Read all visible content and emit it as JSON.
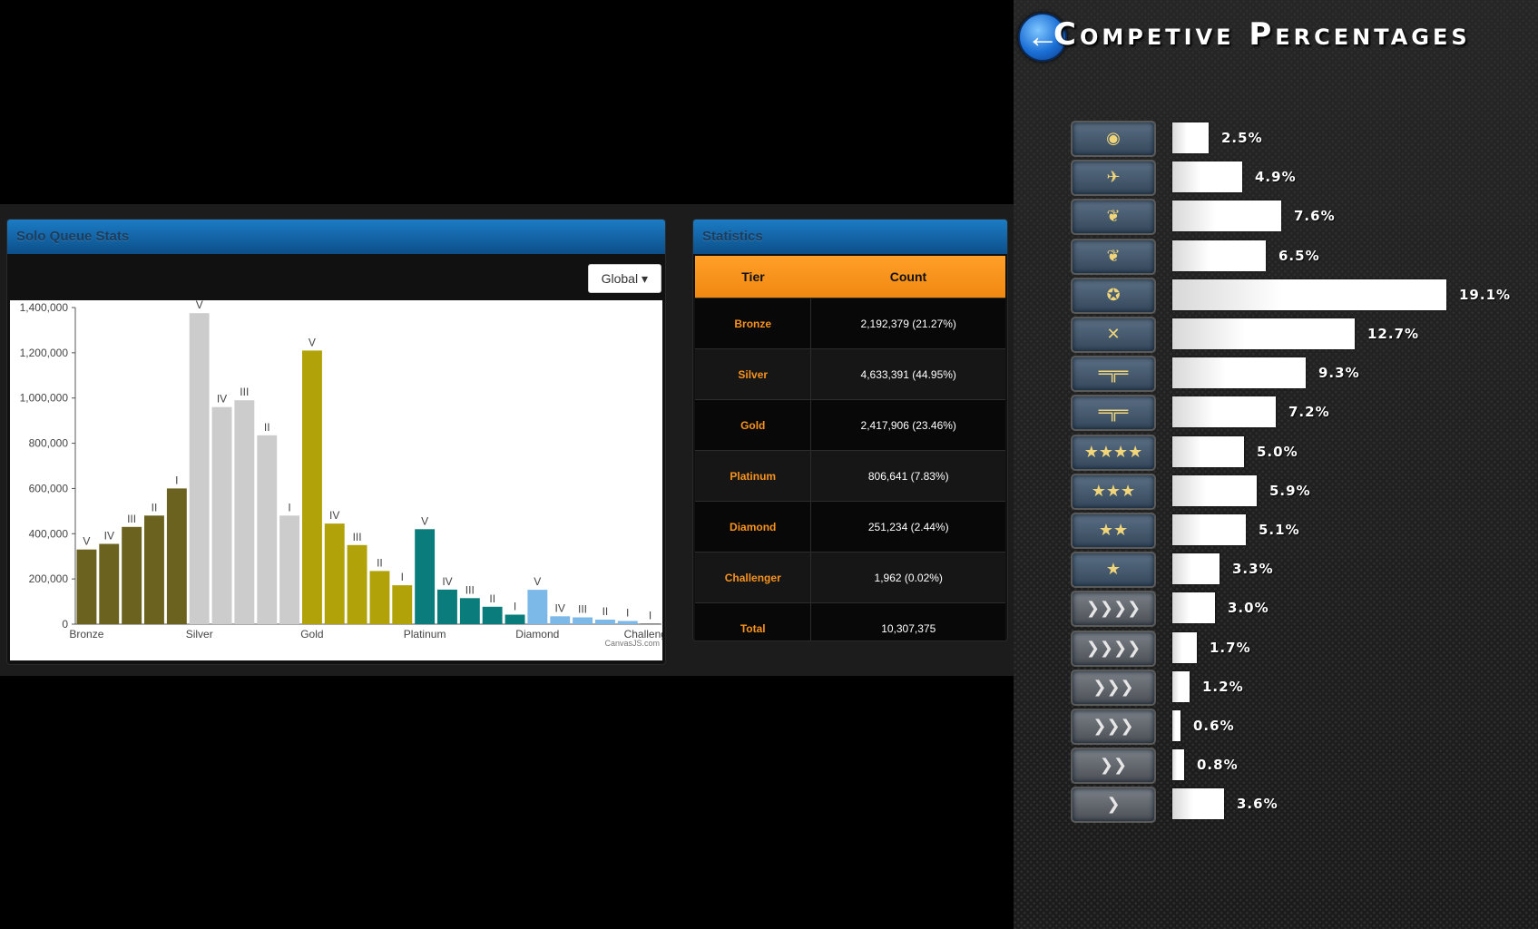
{
  "solo_panel": {
    "title": "Solo Queue Stats",
    "region_button": "Global ▾",
    "watermark": "CanvasJS.com"
  },
  "chart_data": {
    "type": "bar",
    "ylim": [
      0,
      1400000
    ],
    "yticks": [
      "0",
      "200,000",
      "400,000",
      "600,000",
      "800,000",
      "1,000,000",
      "1,200,000",
      "1,400,000"
    ],
    "tier_labels": [
      "Bronze",
      "Silver",
      "Gold",
      "Platinum",
      "Diamond",
      "Challenger"
    ],
    "bars": [
      {
        "tier": "Bronze",
        "division": "V",
        "value": 330000,
        "color": "#6b6220"
      },
      {
        "tier": "Bronze",
        "division": "IV",
        "value": 355000,
        "color": "#6b6220"
      },
      {
        "tier": "Bronze",
        "division": "III",
        "value": 430000,
        "color": "#6b6220"
      },
      {
        "tier": "Bronze",
        "division": "II",
        "value": 480000,
        "color": "#6b6220"
      },
      {
        "tier": "Bronze",
        "division": "I",
        "value": 600000,
        "color": "#6b6220"
      },
      {
        "tier": "Silver",
        "division": "V",
        "value": 1375000,
        "color": "#cccccc"
      },
      {
        "tier": "Silver",
        "division": "IV",
        "value": 960000,
        "color": "#cccccc"
      },
      {
        "tier": "Silver",
        "division": "III",
        "value": 990000,
        "color": "#cccccc"
      },
      {
        "tier": "Silver",
        "division": "II",
        "value": 835000,
        "color": "#cccccc"
      },
      {
        "tier": "Silver",
        "division": "I",
        "value": 480000,
        "color": "#cccccc"
      },
      {
        "tier": "Gold",
        "division": "V",
        "value": 1210000,
        "color": "#b1a20a"
      },
      {
        "tier": "Gold",
        "division": "IV",
        "value": 445000,
        "color": "#b1a20a"
      },
      {
        "tier": "Gold",
        "division": "III",
        "value": 350000,
        "color": "#b1a20a"
      },
      {
        "tier": "Gold",
        "division": "II",
        "value": 235000,
        "color": "#b1a20a"
      },
      {
        "tier": "Gold",
        "division": "I",
        "value": 172000,
        "color": "#b1a20a"
      },
      {
        "tier": "Platinum",
        "division": "V",
        "value": 420000,
        "color": "#0a7c7c"
      },
      {
        "tier": "Platinum",
        "division": "IV",
        "value": 153000,
        "color": "#0a7c7c"
      },
      {
        "tier": "Platinum",
        "division": "III",
        "value": 115000,
        "color": "#0a7c7c"
      },
      {
        "tier": "Platinum",
        "division": "II",
        "value": 77000,
        "color": "#0a7c7c"
      },
      {
        "tier": "Platinum",
        "division": "I",
        "value": 42000,
        "color": "#0a7c7c"
      },
      {
        "tier": "Diamond",
        "division": "V",
        "value": 152000,
        "color": "#7db9e8"
      },
      {
        "tier": "Diamond",
        "division": "IV",
        "value": 35000,
        "color": "#7db9e8"
      },
      {
        "tier": "Diamond",
        "division": "III",
        "value": 30000,
        "color": "#7db9e8"
      },
      {
        "tier": "Diamond",
        "division": "II",
        "value": 20000,
        "color": "#7db9e8"
      },
      {
        "tier": "Diamond",
        "division": "I",
        "value": 14000,
        "color": "#7db9e8"
      },
      {
        "tier": "Challenger",
        "division": "I",
        "value": 1962,
        "color": "#111111"
      }
    ]
  },
  "stats_panel": {
    "title": "Statistics",
    "headers": [
      "Tier",
      "Count"
    ],
    "rows": [
      {
        "tier": "Bronze",
        "count": "2,192,379 (21.27%)"
      },
      {
        "tier": "Silver",
        "count": "4,633,391 (44.95%)"
      },
      {
        "tier": "Gold",
        "count": "2,417,906 (23.46%)"
      },
      {
        "tier": "Platinum",
        "count": "806,641 (7.83%)"
      },
      {
        "tier": "Diamond",
        "count": "251,234 (2.44%)"
      },
      {
        "tier": "Challenger",
        "count": "1,962 (0.02%)"
      },
      {
        "tier": "Total",
        "count": "10,307,375"
      }
    ]
  },
  "competitive": {
    "title": "Competive Percentages",
    "ranks": [
      {
        "icon": "globe-icon",
        "glyph": "◉",
        "badge": "gold",
        "percent": 2.5,
        "label": "2.5%"
      },
      {
        "icon": "winged-emblem-icon",
        "glyph": "✈",
        "badge": "gold",
        "percent": 4.9,
        "label": "4.9%"
      },
      {
        "icon": "eagle-laurel-icon",
        "glyph": "❦",
        "badge": "gold",
        "percent": 7.6,
        "label": "7.6%"
      },
      {
        "icon": "eagle-icon",
        "glyph": "❦",
        "badge": "gold",
        "percent": 6.5,
        "label": "6.5%"
      },
      {
        "icon": "star-emblem-icon",
        "glyph": "✪",
        "badge": "gold",
        "percent": 19.1,
        "label": "19.1%"
      },
      {
        "icon": "crossed-rifles-icon",
        "glyph": "✕",
        "badge": "gold",
        "percent": 12.7,
        "label": "12.7%"
      },
      {
        "icon": "rifle-laurel-icon",
        "glyph": "═╦═",
        "badge": "gold",
        "percent": 9.3,
        "label": "9.3%"
      },
      {
        "icon": "rifle-icon",
        "glyph": "═╦═",
        "badge": "gold",
        "percent": 7.2,
        "label": "7.2%"
      },
      {
        "icon": "four-stars-icon",
        "glyph": "★★★★",
        "badge": "gold",
        "percent": 5.0,
        "label": "5.0%"
      },
      {
        "icon": "three-stars-icon",
        "glyph": "★★★",
        "badge": "gold",
        "percent": 5.9,
        "label": "5.9%"
      },
      {
        "icon": "two-stars-icon",
        "glyph": "★★",
        "badge": "gold",
        "percent": 5.1,
        "label": "5.1%"
      },
      {
        "icon": "one-star-icon",
        "glyph": "★",
        "badge": "gold",
        "percent": 3.3,
        "label": "3.3%"
      },
      {
        "icon": "chevrons-six-icon",
        "glyph": "❯❯❯❯",
        "badge": "silver",
        "percent": 3.0,
        "label": "3.0%"
      },
      {
        "icon": "chevrons-five-icon",
        "glyph": "❯❯❯❯",
        "badge": "silver",
        "percent": 1.7,
        "label": "1.7%"
      },
      {
        "icon": "chevrons-four-icon",
        "glyph": "❯❯❯",
        "badge": "silver",
        "percent": 1.2,
        "label": "1.2%"
      },
      {
        "icon": "chevrons-three-icon",
        "glyph": "❯❯❯",
        "badge": "silver",
        "percent": 0.6,
        "label": "0.6%"
      },
      {
        "icon": "chevrons-two-icon",
        "glyph": "❯❯",
        "badge": "silver",
        "percent": 0.8,
        "label": "0.8%"
      },
      {
        "icon": "chevron-one-icon",
        "glyph": "❯",
        "badge": "silver",
        "percent": 3.6,
        "label": "3.6%"
      }
    ]
  }
}
